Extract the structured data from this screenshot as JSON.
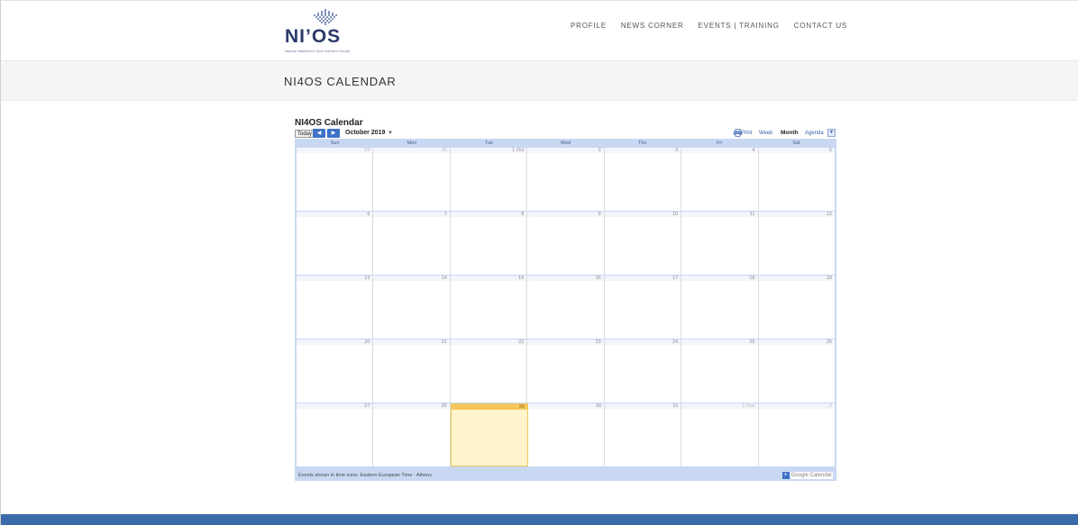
{
  "brand": {
    "logo_text": "NI’OS",
    "tagline": "National Initiatives for Open Science in Europe"
  },
  "nav": {
    "items": [
      "PROFILE",
      "NEWS CORNER",
      "EVENTS | TRAINING",
      "CONTACT US"
    ]
  },
  "page": {
    "title": "NI4OS CALENDAR"
  },
  "calendar": {
    "title": "NI4OS Calendar",
    "today_label": "Today",
    "prev_label": "◀",
    "next_label": "▶",
    "current_period": "October 2019",
    "period_caret": "▼",
    "print_label": "Print",
    "views": {
      "week": "Week",
      "month": "Month",
      "agenda": "Agenda"
    },
    "tz_toggle": "▾",
    "weekdays": [
      "Sun",
      "Mon",
      "Tue",
      "Wed",
      "Thu",
      "Fri",
      "Sat"
    ],
    "weeks": [
      [
        "29",
        "30",
        "1 Oct",
        "2",
        "3",
        "4",
        "5"
      ],
      [
        "6",
        "7",
        "8",
        "9",
        "10",
        "11",
        "12"
      ],
      [
        "13",
        "14",
        "15",
        "16",
        "17",
        "18",
        "19"
      ],
      [
        "20",
        "21",
        "22",
        "23",
        "24",
        "25",
        "26"
      ],
      [
        "27",
        "28",
        "29",
        "30",
        "31",
        "1 Nov",
        "2"
      ]
    ],
    "footer_note": "Events shown in time zone: Eastern European Time - Athens",
    "google_plus": "+",
    "google_label": "Google Calendar"
  }
}
